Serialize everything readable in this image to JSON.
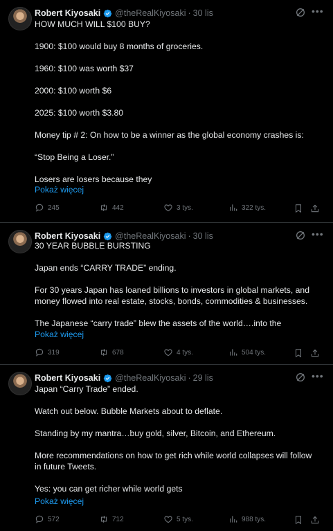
{
  "tweets": [
    {
      "author": "Robert Kiyosaki",
      "handle": "@theRealKiyosaki",
      "time": "30 lis",
      "lines": [
        "HOW MUCH WILL $100 BUY?",
        "",
        "1900:  $100  would buy 8 months of groceries.",
        "",
        "1960:  $100 was worth $37",
        "",
        "2000: $100 worth $6",
        "",
        "2025:  $100 worth  $3.80",
        "",
        "Money tip # 2:  On how to be a winner as the global economy crashes is:",
        "",
        "“Stop Being a  Loser.”",
        "",
        "Losers are losers because they"
      ],
      "show_more": "Pokaż więcej",
      "replies": "245",
      "reposts": "442",
      "likes": "3 tys.",
      "views": "322 tys."
    },
    {
      "author": "Robert Kiyosaki",
      "handle": "@theRealKiyosaki",
      "time": "30 lis",
      "lines": [
        "30 YEAR BUBBLE BURSTING",
        "",
        "Japan ends “CARRY TRADE” ending.",
        "",
        "For 30 years Japan has loaned billions to investors in global markets, and",
        "money flowed into real estate, stocks, bonds, commodities & businesses.",
        "",
        "The Japanese “carry trade” blew the assets of the world….into the"
      ],
      "show_more": "Pokaż więcej",
      "replies": "319",
      "reposts": "678",
      "likes": "4 tys.",
      "views": "504 tys."
    },
    {
      "author": "Robert Kiyosaki",
      "handle": "@theRealKiyosaki",
      "time": "29 lis",
      "lines": [
        "Japan “Carry Trade” ended.",
        "",
        "Watch out below.  Bubble Markets about to deflate.",
        "",
        "Standing by my mantra…buy gold, silver, Bitcoin, and Ethereum.",
        "",
        "More recommendations on how to get rich while world collapses will follow",
        "in future Tweets.",
        "",
        "Yes:  you can get richer while world gets"
      ],
      "show_more": "Pokaż więcej",
      "replies": "572",
      "reposts": "712",
      "likes": "5 tys.",
      "views": "988 tys."
    }
  ],
  "icons": {
    "verified": "verified-badge-icon",
    "grok": "grok-icon",
    "more": "more-icon",
    "reply": "reply-icon",
    "repost": "repost-icon",
    "like": "like-icon",
    "views": "views-icon",
    "bookmark": "bookmark-icon",
    "share": "share-icon"
  },
  "colors": {
    "background": "#000000",
    "text": "#e7e9ea",
    "muted": "#71767b",
    "link": "#1d9bf0",
    "divider": "#2f3336"
  }
}
